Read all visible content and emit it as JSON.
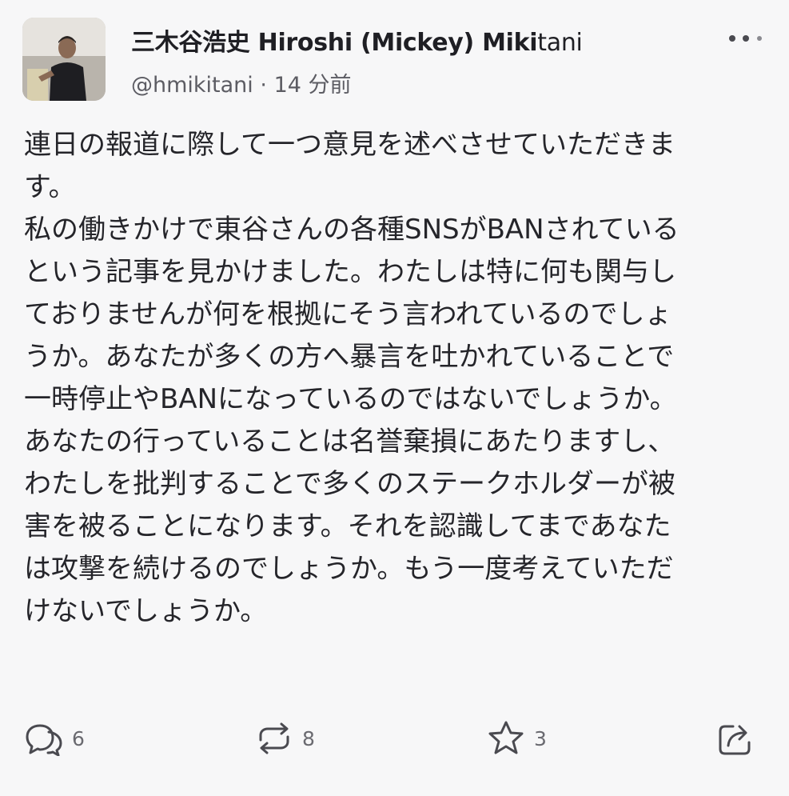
{
  "post": {
    "author": {
      "name_bold": "三木谷浩史 Hiroshi (Mickey) Miki",
      "name_tail": "tani",
      "handle": "@hmikitani",
      "separator": "·",
      "time": "14 分前"
    },
    "body_lines": [
      "連日の報道に際して一つ意見を述べさせていただきま",
      "す。",
      "私の働きかけで東谷さんの各種SNSがBANされている",
      "という記事を見かけました。わたしは特に何も関与し",
      "ておりませんが何を根拠にそう言われているのでしょ",
      "うか。あなたが多くの方へ暴言を吐かれていることで",
      "一時停止やBANになっているのではないでしょうか。",
      "あなたの行っていることは名誉棄損にあたりますし、",
      "わたしを批判することで多くのステークホルダーが被",
      "害を被ることになります。それを認識してまであなた",
      "は攻撃を続けるのでしょうか。もう一度考えていただ",
      "けないでしょうか。"
    ],
    "actions": {
      "reply": {
        "icon": "reply-icon",
        "count": "6"
      },
      "repost": {
        "icon": "repost-icon",
        "count": "8"
      },
      "like": {
        "icon": "star-icon",
        "count": "3"
      },
      "share": {
        "icon": "share-icon"
      }
    }
  },
  "colors": {
    "background": "#f7f7f8",
    "text": "#25252a",
    "muted": "#5c5c63",
    "icon": "#4a4a50"
  }
}
